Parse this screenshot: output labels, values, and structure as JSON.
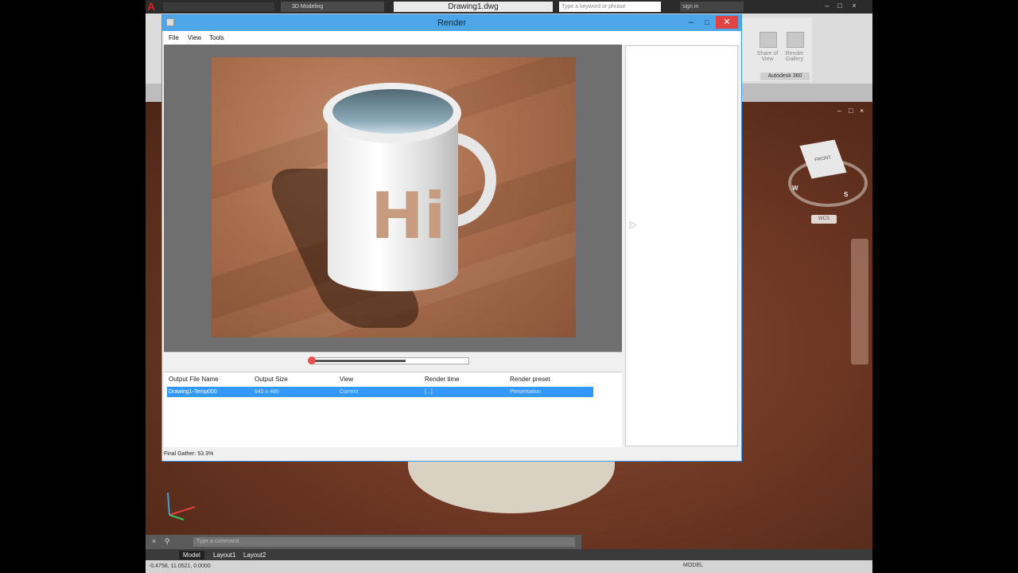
{
  "acad": {
    "workspace": "3D Modeling",
    "document_title": "Drawing1.dwg",
    "search_placeholder": "Type a keyword or phrase",
    "signin": "sign in",
    "ribbon": {
      "share_view": "Share of View",
      "render_gallery": "Render Gallery",
      "panel_label": "Autodesk 360"
    },
    "viewcube": {
      "face": "FRONT",
      "wcs": "WCS"
    },
    "compass": [
      "W",
      "S"
    ],
    "command_placeholder": "Type a command",
    "layout_tabs": [
      "Model",
      "Layout1",
      "Layout2"
    ],
    "coords": "-0.4758, 11.0521, 0.0000",
    "model_label": "MODEL"
  },
  "render": {
    "title": "Render",
    "menu": [
      "File",
      "View",
      "Tools"
    ],
    "progress": 0.6,
    "history": {
      "columns": [
        "Output File Name",
        "Output Size",
        "View",
        "Render time",
        "Render preset"
      ],
      "rows": [
        [
          "Drawing1-Temp000",
          "640 x 480",
          "Current",
          "[...]",
          "Presentation"
        ]
      ]
    },
    "status": "Final Gather: 53.3%"
  }
}
